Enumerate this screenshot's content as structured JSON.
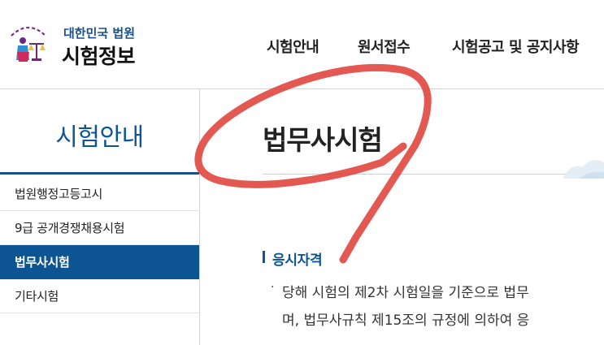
{
  "header": {
    "logo_subtitle": "대한민국 법원",
    "logo_title": "시험정보",
    "nav": [
      {
        "label": "시험안내"
      },
      {
        "label": "원서접수"
      },
      {
        "label": "시험공고 및 공지사항"
      }
    ]
  },
  "sidebar": {
    "title": "시험안내",
    "items": [
      {
        "label": "법원행정고등고시",
        "active": false
      },
      {
        "label": "9급 공개경쟁채용시험",
        "active": false
      },
      {
        "label": "법무사시험",
        "active": true
      },
      {
        "label": "기타시험",
        "active": false
      }
    ]
  },
  "main": {
    "page_title": "법무사시험",
    "section_title": "응시자격",
    "bullet": "·",
    "line1": "당해 시험의 제2차 시험일을 기준으로 법무",
    "line2": "며, 법무사규칙 제15조의 규정에 의하여 응"
  },
  "colors": {
    "accent": "#0d5493",
    "pen": "#e0413a"
  },
  "icons": {
    "logo": "court-emblem-icon",
    "section_marker": "section-bar-icon",
    "decoration": "cloud-illustration"
  }
}
